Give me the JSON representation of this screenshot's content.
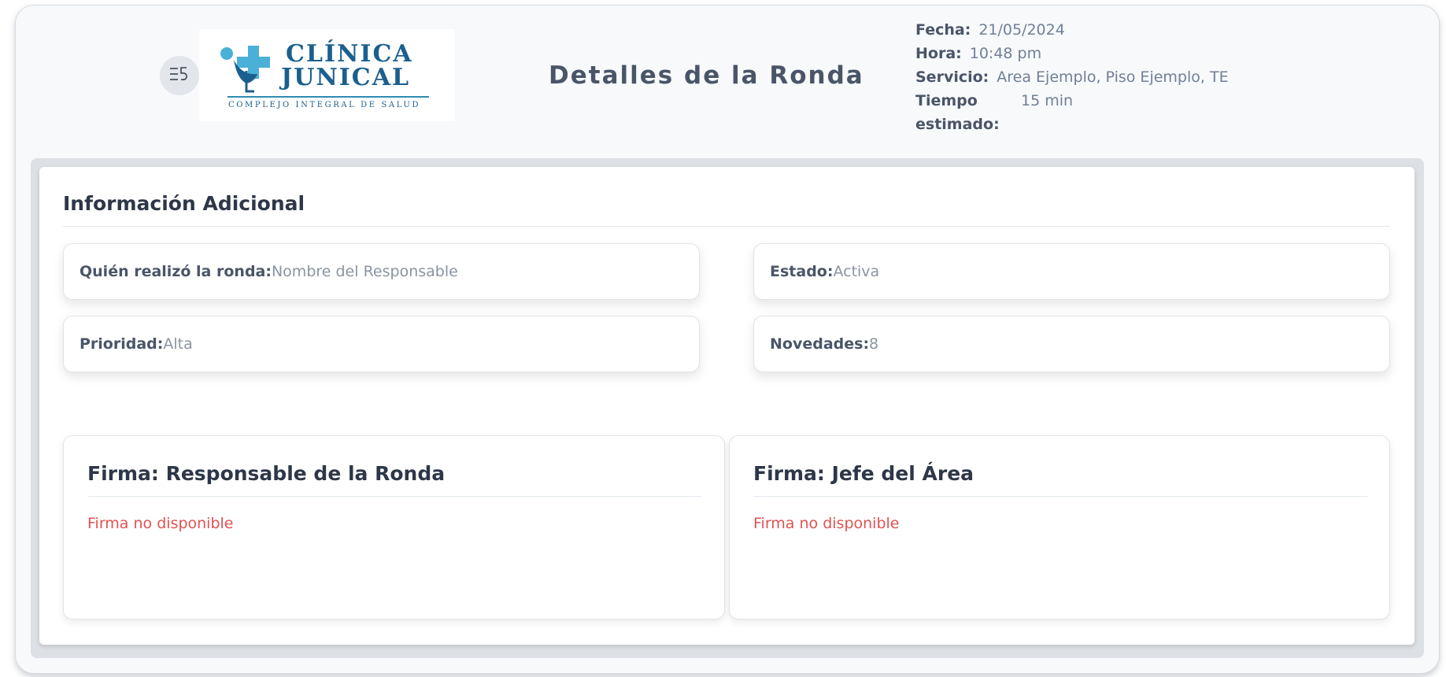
{
  "header": {
    "menu_icon": "menu-collapse-icon",
    "menu_glyph": "☰",
    "logo": {
      "line1": "CLÍNICA",
      "line2": "JUNICAL",
      "subtitle": "COMPLEJO INTEGRAL DE SALUD"
    },
    "title": "Detalles de la Ronda",
    "meta": {
      "fecha_label": "Fecha:",
      "fecha_value": "21/05/2024",
      "hora_label": "Hora:",
      "hora_value": "10:48 pm",
      "servicio_label": "Servicio:",
      "servicio_value": "Area Ejemplo, Piso Ejemplo, TE",
      "tiempo_label": "Tiempo estimado:",
      "tiempo_value": "15 min"
    }
  },
  "info": {
    "title": "Información Adicional",
    "responsable_label": "Quién realizó la ronda:",
    "responsable_value": "Nombre del Responsable",
    "estado_label": "Estado:",
    "estado_value": "Activa",
    "prioridad_label": "Prioridad:",
    "prioridad_value": "Alta",
    "novedades_label": "Novedades:",
    "novedades_value": "8"
  },
  "firmas": {
    "responsable_title": "Firma: Responsable de la Ronda",
    "responsable_status": "Firma no disponible",
    "jefe_title": "Firma: Jefe del Área",
    "jefe_status": "Firma no disponible"
  },
  "colors": {
    "accent": "#1b5f8f",
    "logo_light": "#4ab0d8",
    "error": "#e05252",
    "background": "#f7f9fb"
  }
}
